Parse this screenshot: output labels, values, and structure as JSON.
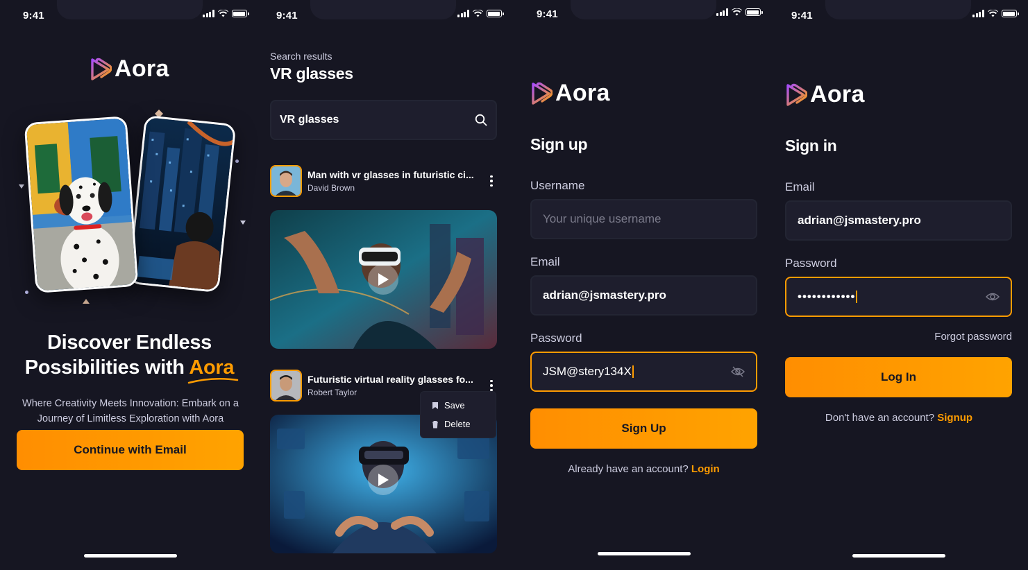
{
  "status_bar": {
    "time": "9:41"
  },
  "brand": {
    "name": "Aora",
    "accent": "#ff9c01",
    "bg": "#161622",
    "logo_grad_a": "#a64cff",
    "logo_grad_b": "#ffa300"
  },
  "onboarding": {
    "headline_line1": "Discover Endless",
    "headline_line2_prefix": "Possibilities with",
    "headline_accent": "Aora",
    "subtext": "Where Creativity Meets Innovation: Embark on a Journey of Limitless Exploration with Aora",
    "cta_label": "Continue with Email"
  },
  "search": {
    "label": "Search results",
    "query_title": "VR glasses",
    "input_value": "VR glasses",
    "videos": [
      {
        "title": "Man with vr glasses in futuristic ci...",
        "author": "David Brown"
      },
      {
        "title": "Futuristic virtual reality glasses fo...",
        "author": "Robert Taylor"
      }
    ],
    "menu": {
      "save": "Save",
      "delete": "Delete"
    }
  },
  "signup": {
    "title": "Sign up",
    "username_label": "Username",
    "username_placeholder": "Your unique username",
    "email_label": "Email",
    "email_value": "adrian@jsmastery.pro",
    "password_label": "Password",
    "password_value": "JSM@stery134X",
    "submit_label": "Sign Up",
    "footer_text": "Already have an account?",
    "footer_link": "Login"
  },
  "signin": {
    "title": "Sign in",
    "email_label": "Email",
    "email_value": "adrian@jsmastery.pro",
    "password_label": "Password",
    "password_value": "••••••••••••",
    "forgot_label": "Forgot password",
    "submit_label": "Log In",
    "footer_text": "Don't have an account?",
    "footer_link": "Signup"
  }
}
